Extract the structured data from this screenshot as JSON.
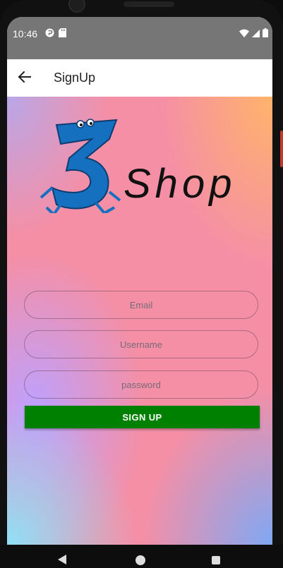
{
  "status_bar": {
    "time": "10:46"
  },
  "app_bar": {
    "title": "SignUp"
  },
  "logo": {
    "brand_text": "Shop",
    "mark": "3"
  },
  "form": {
    "email_placeholder": "Email",
    "username_placeholder": "Username",
    "password_placeholder": "password",
    "email_value": "",
    "username_value": "",
    "password_value": "",
    "submit_label": "SIGN UP"
  },
  "colors": {
    "status_bar": "#767676",
    "button": "#008000",
    "logo_blue": "#1670c0"
  },
  "icons": [
    "back-arrow-icon",
    "wifi-icon",
    "signal-icon",
    "battery-icon",
    "notification-icon",
    "sd-card-icon"
  ]
}
